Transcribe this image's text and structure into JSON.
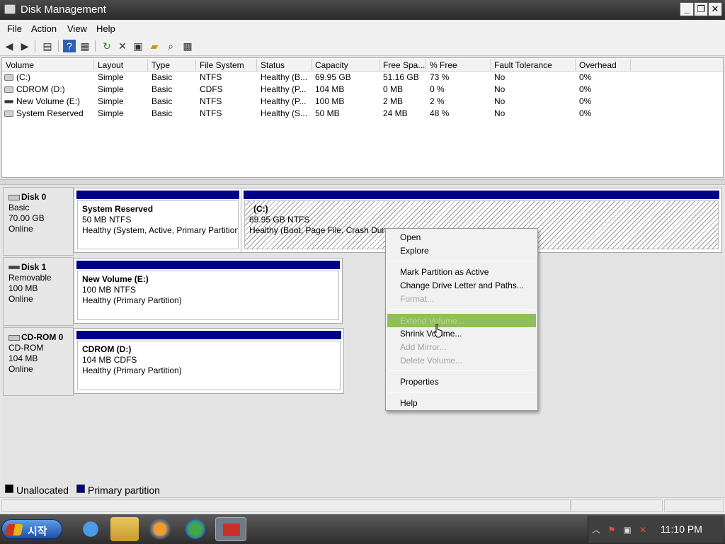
{
  "window": {
    "title": "Disk Management",
    "controls": {
      "minimize": "_",
      "restore": "❐",
      "close": "✕"
    }
  },
  "menu": [
    "File",
    "Action",
    "View",
    "Help"
  ],
  "volume_list": {
    "columns": [
      "Volume",
      "Layout",
      "Type",
      "File System",
      "Status",
      "Capacity",
      "Free Spa...",
      "% Free",
      "Fault Tolerance",
      "Overhead"
    ],
    "rows": [
      [
        "(C:)",
        "Simple",
        "Basic",
        "NTFS",
        "Healthy (B...",
        "69.95 GB",
        "51.16 GB",
        "73 %",
        "No",
        "0%"
      ],
      [
        "CDROM (D:)",
        "Simple",
        "Basic",
        "CDFS",
        "Healthy (P...",
        "104 MB",
        "0 MB",
        "0 %",
        "No",
        "0%"
      ],
      [
        "New Volume (E:)",
        "Simple",
        "Basic",
        "NTFS",
        "Healthy (P...",
        "100 MB",
        "2 MB",
        "2 %",
        "No",
        "0%"
      ],
      [
        "System Reserved",
        "Simple",
        "Basic",
        "NTFS",
        "Healthy (S...",
        "50 MB",
        "24 MB",
        "48 %",
        "No",
        "0%"
      ]
    ]
  },
  "disks": [
    {
      "name": "Disk 0",
      "kind": "Basic",
      "size": "70.00 GB",
      "state": "Online",
      "partitions": [
        {
          "name": "System Reserved",
          "size": "50 MB NTFS",
          "status": "Healthy (System, Active, Primary Partition"
        },
        {
          "name": "(C:)",
          "size": "69.95 GB NTFS",
          "status": "Healthy (Boot, Page File, Crash Dum"
        }
      ]
    },
    {
      "name": "Disk 1",
      "kind": "Removable",
      "size": "100 MB",
      "state": "Online",
      "partitions": [
        {
          "name": "New Volume  (E:)",
          "size": "100 MB NTFS",
          "status": "Healthy (Primary Partition)"
        }
      ]
    },
    {
      "name": "CD-ROM 0",
      "kind": "CD-ROM",
      "size": "104 MB",
      "state": "Online",
      "partitions": [
        {
          "name": "CDROM  (D:)",
          "size": "104 MB CDFS",
          "status": "Healthy (Primary Partition)"
        }
      ]
    }
  ],
  "legend": [
    {
      "label": "Unallocated",
      "color": "#000000"
    },
    {
      "label": "Primary partition",
      "color": "#00008b"
    }
  ],
  "context_menu": {
    "items": [
      {
        "label": "Open",
        "enabled": true
      },
      {
        "label": "Explore",
        "enabled": true
      },
      {
        "label": "Mark Partition as Active",
        "enabled": true
      },
      {
        "label": "Change Drive Letter and Paths...",
        "enabled": true
      },
      {
        "label": "Format...",
        "enabled": false
      },
      {
        "label": "Extend Volume...",
        "enabled": false,
        "highlighted": true
      },
      {
        "label": "Shrink Volume...",
        "enabled": true
      },
      {
        "label": "Add Mirror...",
        "enabled": false
      },
      {
        "label": "Delete Volume...",
        "enabled": false
      },
      {
        "label": "Properties",
        "enabled": true
      },
      {
        "label": "Help",
        "enabled": true
      }
    ]
  },
  "taskbar": {
    "start_label": "시작",
    "clock": "11:10 PM"
  },
  "colors": {
    "primary_partition": "#00008b",
    "menu_highlight": "#8fbf57"
  }
}
